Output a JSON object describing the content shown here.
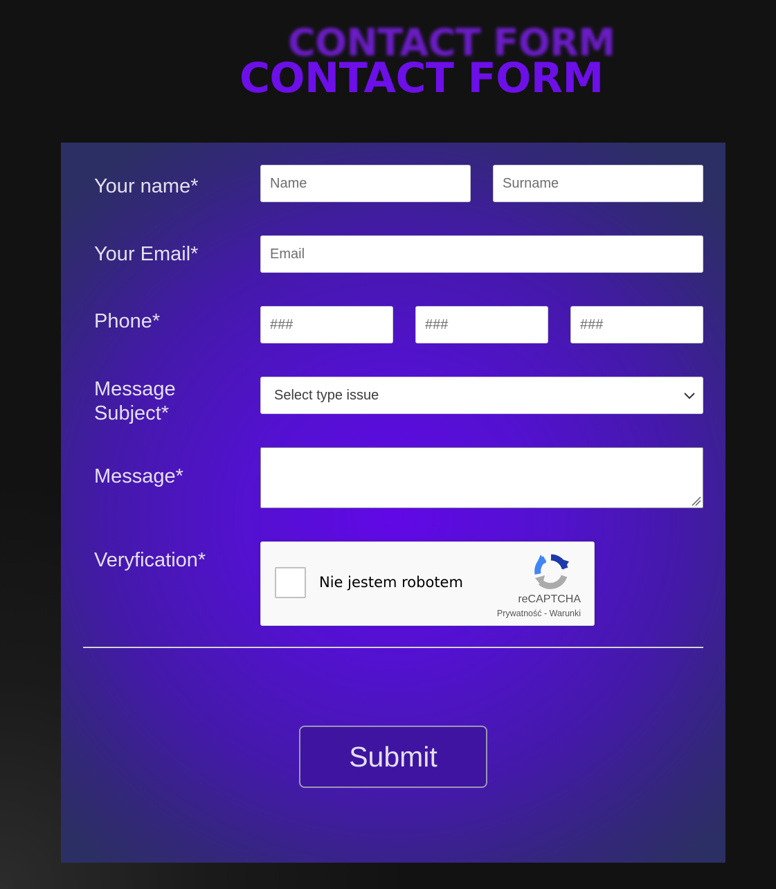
{
  "title": {
    "shadow": "CONTACT FORM",
    "main": "CONTACT FORM"
  },
  "form": {
    "name_label": "Your name*",
    "first_name_placeholder": "Name",
    "surname_placeholder": "Surname",
    "email_label": "Your Email*",
    "email_placeholder": "Email",
    "phone_label": "Phone*",
    "phone_placeholders": [
      "###",
      "###",
      "###"
    ],
    "subject_label": "Message Subject*",
    "subject_selected": "Select type issue",
    "message_label": "Message*",
    "verification_label": "Veryfication*",
    "captcha": {
      "label": "Nie jestem robotem",
      "brand": "reCAPTCHA",
      "links": "Prywatność - Warunki",
      "checked": false
    },
    "submit_label": "Submit"
  },
  "colors": {
    "title": "#6c0fe8",
    "panel_center": "#6108e6",
    "panel_edge": "#2c2f63",
    "submit_bg": "#3f14a0"
  }
}
